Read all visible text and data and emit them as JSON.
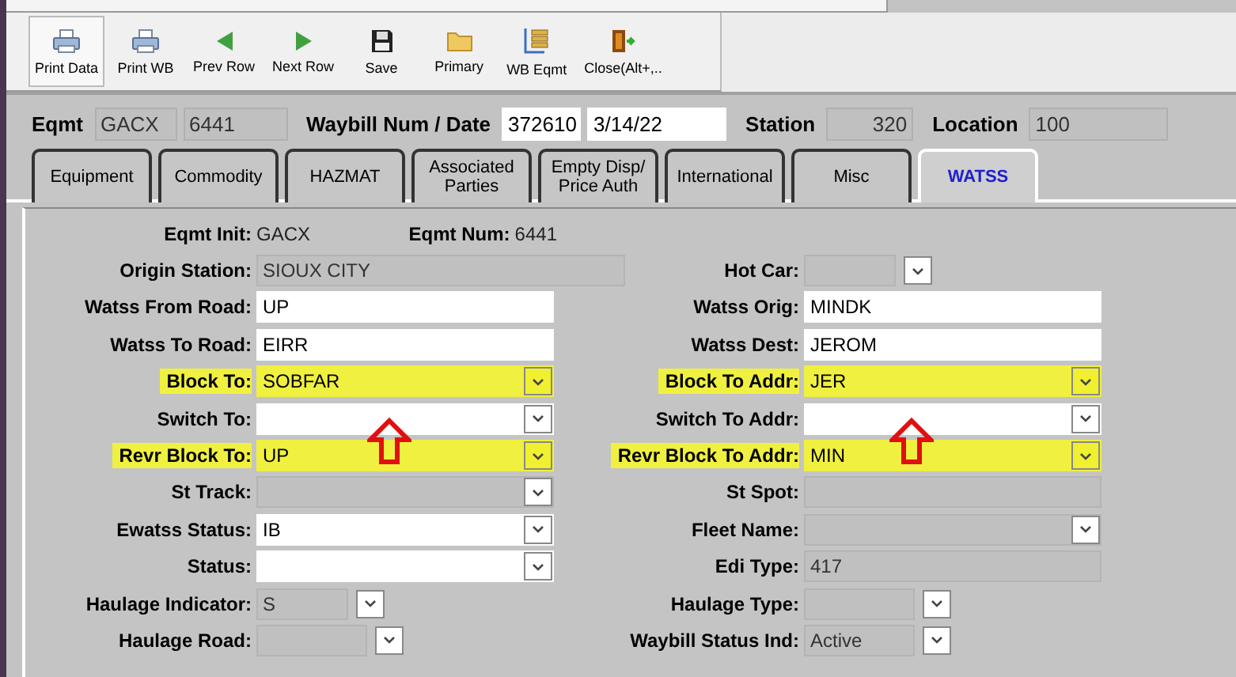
{
  "toolbar": {
    "buttons": [
      {
        "label": "Print Data",
        "kind": "printer"
      },
      {
        "label": "Print WB",
        "kind": "printer"
      },
      {
        "label": "Prev Row",
        "kind": "previous"
      },
      {
        "label": "Next Row",
        "kind": "next"
      },
      {
        "label": "Save",
        "kind": "save"
      },
      {
        "label": "Primary",
        "kind": "folder"
      },
      {
        "label": "WB Eqmt",
        "kind": "list"
      },
      {
        "label": "Close(Alt+,..",
        "kind": "exit"
      }
    ]
  },
  "header": {
    "groups": [
      {
        "label": "Eqmt",
        "fields": [
          {
            "value": "GACX",
            "kind": "readonly"
          },
          {
            "value": "6441",
            "kind": "readonly"
          }
        ]
      },
      {
        "label": "Waybill Num / Date",
        "fields": [
          {
            "value": "372610",
            "kind": "number"
          },
          {
            "value": "3/14/22",
            "kind": "text"
          }
        ]
      },
      {
        "label": "Station",
        "fields": [
          {
            "value": "320",
            "kind": "readonly_number"
          }
        ]
      },
      {
        "label": "Location",
        "fields": [
          {
            "value": "100",
            "kind": "readonly"
          }
        ]
      }
    ]
  },
  "tabs": [
    {
      "label": "Equipment",
      "selected": false
    },
    {
      "label": "Commodity",
      "selected": false
    },
    {
      "label": "HAZMAT",
      "selected": false
    },
    {
      "label": "Associated\nParties",
      "selected": false
    },
    {
      "label": "Empty Disp/\nPrice Auth",
      "selected": false
    },
    {
      "label": "International",
      "selected": false
    },
    {
      "label": "Misc",
      "selected": false
    },
    {
      "label": "WATSS",
      "selected": true
    }
  ],
  "form": {
    "rows": [
      {
        "left": {
          "label": "Eqmt Init:",
          "kind": "plain",
          "value": "GACX",
          "extra_label": "Eqmt Num:",
          "extra_value": "6441"
        }
      },
      {
        "left": {
          "label": "Origin Station:",
          "kind": "readonly_wide",
          "value": "SIOUX CITY"
        },
        "right": {
          "label": "Hot Car:",
          "kind": "combo_gray_short"
        }
      },
      {
        "left": {
          "label": "Watss From Road:",
          "kind": "text",
          "value": "UP"
        },
        "right": {
          "label": "Watss Orig:",
          "kind": "text",
          "value": "MINDK"
        }
      },
      {
        "left": {
          "label": "Watss To Road:",
          "kind": "text",
          "value": "EIRR"
        },
        "right": {
          "label": "Watss Dest:",
          "kind": "text",
          "value": "JEROM"
        }
      },
      {
        "left": {
          "label": "Block To:",
          "kind": "combo",
          "value": "SOBFAR",
          "highlighted": true
        },
        "right": {
          "label": "Block To Addr:",
          "kind": "combo",
          "value": "JER",
          "highlighted": true
        }
      },
      {
        "left": {
          "label": "Switch To:",
          "kind": "combo",
          "arrow_marked": true
        },
        "right": {
          "label": "Switch To Addr:",
          "kind": "combo",
          "arrow_marked": true
        }
      },
      {
        "left": {
          "label": "Revr Block To:",
          "kind": "combo",
          "value": "UP",
          "highlighted": true
        },
        "right": {
          "label": "Revr Block To Addr:",
          "kind": "combo",
          "value": "MIN",
          "highlighted": true
        }
      },
      {
        "left": {
          "label": "St Track:",
          "kind": "combo_gray"
        },
        "right": {
          "label": "St Spot:",
          "kind": "readonly"
        }
      },
      {
        "left": {
          "label": "Ewatss Status:",
          "kind": "combo",
          "value": "IB"
        },
        "right": {
          "label": "Fleet Name:",
          "kind": "combo_gray"
        }
      },
      {
        "left": {
          "label": "Status:",
          "kind": "combo"
        },
        "right": {
          "label": "Edi Type:",
          "kind": "readonly",
          "value": "417"
        }
      },
      {
        "left": {
          "label": "Haulage Indicator:",
          "kind": "combo_gray_short",
          "value": "S"
        },
        "right": {
          "label": "Haulage Type:",
          "kind": "combo_gray_medium"
        }
      },
      {
        "left": {
          "label": "Haulage Road:",
          "kind": "combo_gray_medium"
        },
        "right": {
          "label": "Waybill Status Ind:",
          "kind": "combo_gray_medium",
          "value": "Active"
        }
      }
    ]
  }
}
